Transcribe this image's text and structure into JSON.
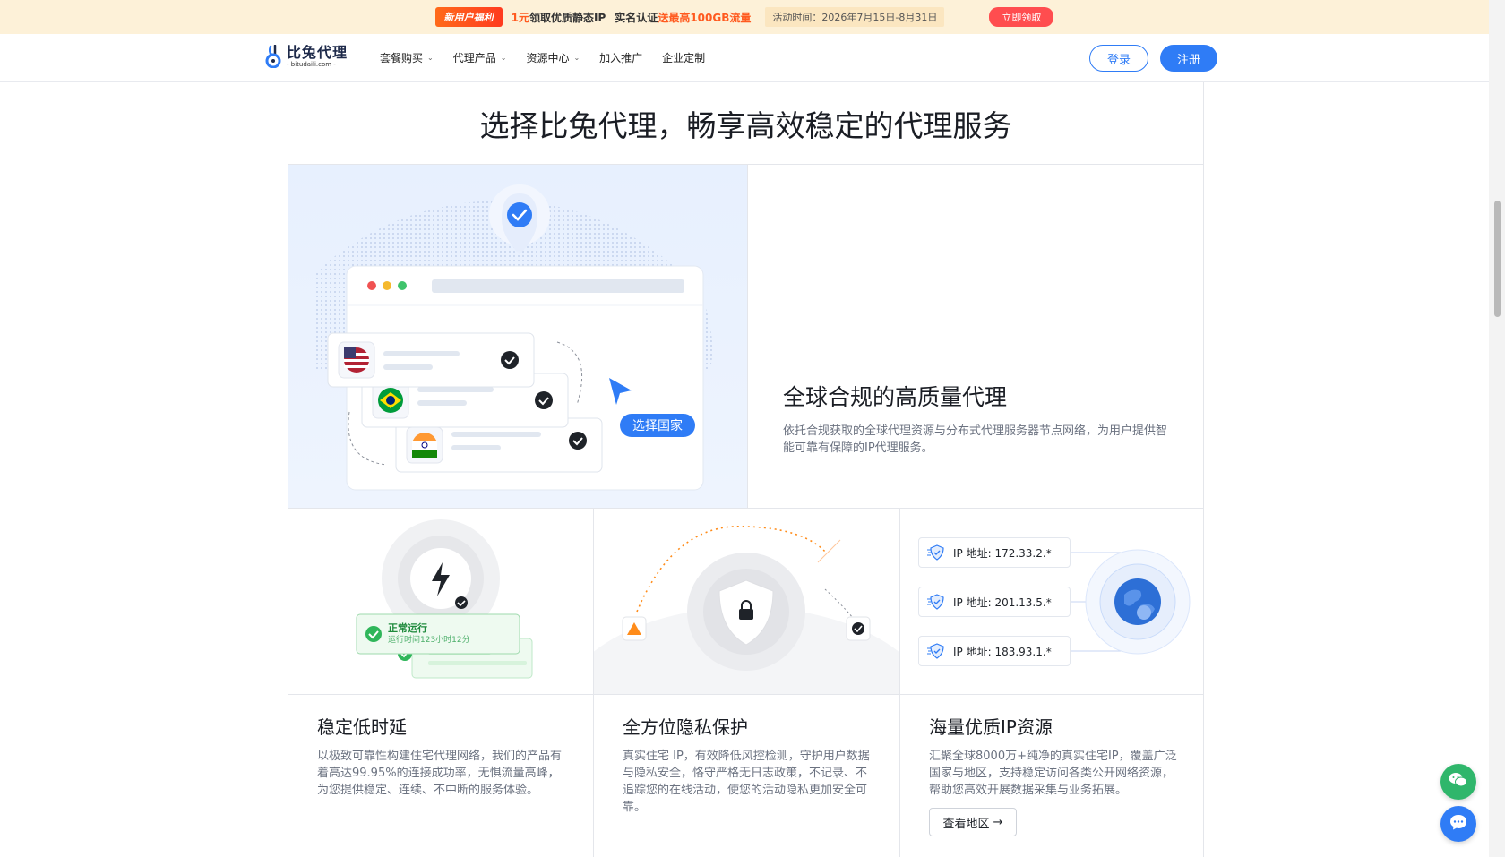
{
  "promo": {
    "tag": "新用户福利",
    "price": "1元",
    "text1": "领取优质静态IP",
    "text2": "实名认证",
    "text3": "送最高100GB流量",
    "date": "活动时间：2026年7月15日-8月31日",
    "cta": "立即领取"
  },
  "nav": {
    "logo_name": "比兔代理",
    "logo_domain": "- bitudaili.com -",
    "menu": [
      {
        "label": "套餐购买",
        "dropdown": true
      },
      {
        "label": "代理产品",
        "dropdown": true
      },
      {
        "label": "资源中心",
        "dropdown": true
      },
      {
        "label": "加入推广",
        "dropdown": false
      },
      {
        "label": "企业定制",
        "dropdown": false
      }
    ],
    "login": "登录",
    "register": "注册"
  },
  "section": {
    "title": "选择比兔代理，畅享高效稳定的代理服务"
  },
  "hero": {
    "select_country": "选择国家",
    "title": "全球合规的高质量代理",
    "desc": "依托合规获取的全球代理资源与分布式代理服务器节点网络，为用户提供智能可靠有保障的IP代理服务。"
  },
  "cards": [
    {
      "status": "正常运行",
      "uptime": "运行时间123小时12分",
      "title": "稳定低时延",
      "desc": "以极致可靠性构建住宅代理网络，我们的产品有着高达99.95%的连接成功率，无惧流量高峰，为您提供稳定、连续、不中断的服务体验。"
    },
    {
      "title": "全方位隐私保护",
      "desc": "真实住宅 IP，有效降低风控检测，守护用户数据与隐私安全，恪守严格无日志政策，不记录、不追踪您的在线活动，使您的活动隐私更加安全可靠。"
    },
    {
      "ips": [
        "IP 地址: 172.33.2.*",
        "IP 地址: 201.13.5.*",
        "IP 地址: 183.93.1.*"
      ],
      "title": "海量优质IP资源",
      "desc": "汇聚全球8000万+纯净的真实住宅IP，覆盖广泛国家与地区，支持稳定访问各类公开网络资源，帮助您高效开展数据采集与业务拓展。",
      "button": "查看地区"
    }
  ],
  "colors": {
    "primary": "#2f7cf6",
    "promo_bg": "#fdf1d8",
    "accent_orange": "#ff5a1f",
    "success_green": "#2fb66b"
  }
}
